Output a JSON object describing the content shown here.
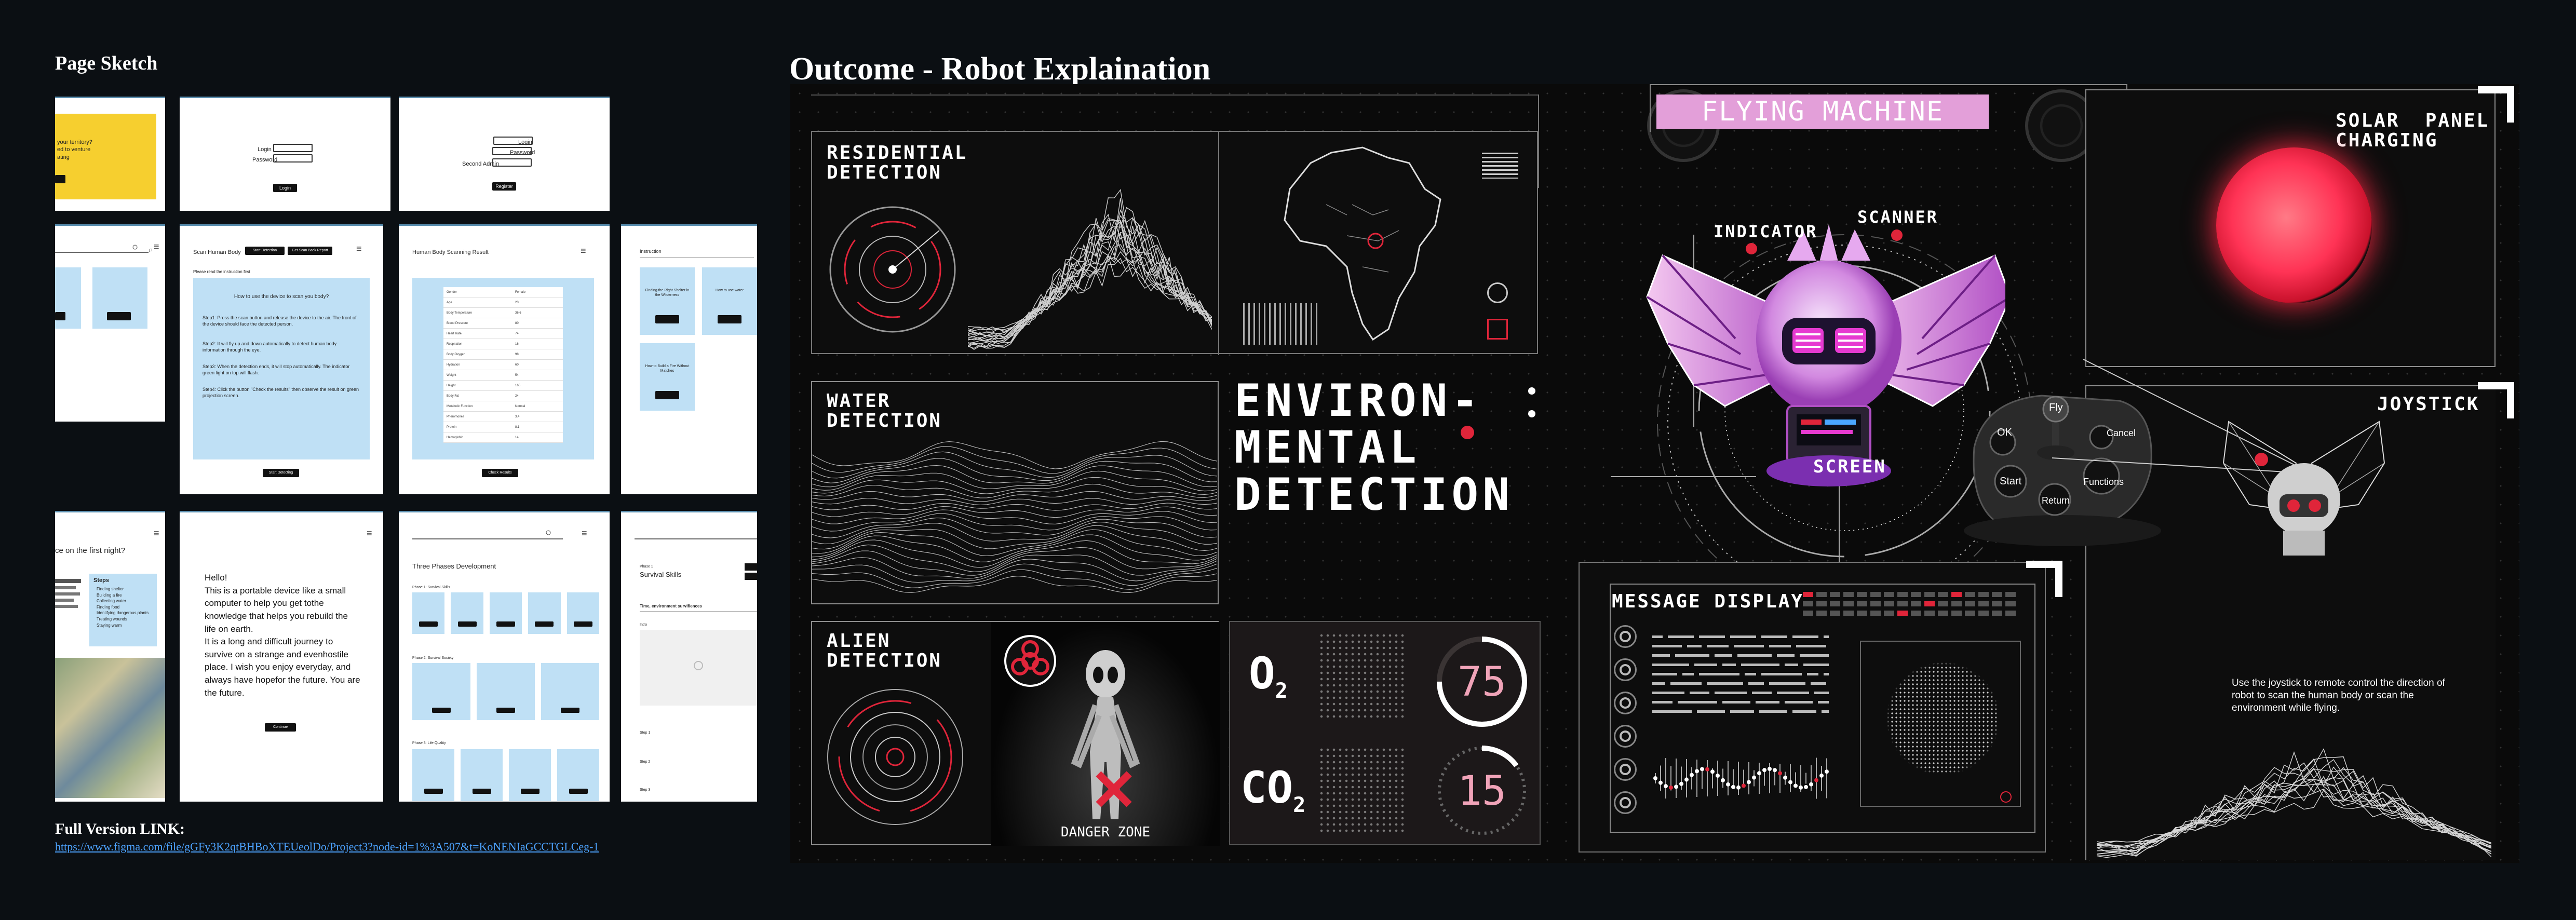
{
  "left": {
    "heading": "Page Sketch",
    "link_label": "Full Version LINK:",
    "link_url": "https://www.figma.com/file/gGFy3K2qtBHBoXTEUeolDo/Project3?node-id=1%3A507&t=KoNENIaGCCTGLCeg-1",
    "frames": {
      "f1_lines": [
        "your territory?",
        "ed to venture",
        "ating"
      ],
      "login_labels": [
        "Login",
        "Password"
      ],
      "login_btn": "Login",
      "register_labels": [
        "Login",
        "Password",
        "Second Admin"
      ],
      "register_btn": "Register",
      "scan_title": "Scan Human Body",
      "scan_tabs": [
        "Start Detection",
        "Get Scan Back Report"
      ],
      "scan_note": "Please read the instruction first",
      "scan_question": "How to use the device to scan you body?",
      "scan_steps": [
        "Step1: Press the scan button and release the device to the air. The front of the device should face the detected person.",
        "Step2: It will fly up and down automatically to detect human body information through the eye.",
        "Step3: When the detection ends, it will stop automatically. The indicator green light on top will flash.",
        "Step4: Click the button \"Check the results\" then observe the result on green projection screen."
      ],
      "scan_btn": "Start Detecting",
      "result_title": "Human Body Scanning Result",
      "result_rows": [
        [
          "Gender",
          "Female"
        ],
        [
          "Age",
          "23"
        ],
        [
          "Body Temperature",
          "36.6"
        ],
        [
          "Blood Pressure",
          "80"
        ],
        [
          "Heart Rate",
          "74"
        ],
        [
          "Respiration",
          "16"
        ],
        [
          "Body Oxygen",
          "98"
        ],
        [
          "Hydration",
          "60"
        ],
        [
          "Weight",
          "54"
        ],
        [
          "Height",
          "165"
        ],
        [
          "Body Fat",
          "24"
        ],
        [
          "Metabolic Function",
          "Normal"
        ],
        [
          "Pheromones",
          "3.4"
        ],
        [
          "Protein",
          "8.1"
        ],
        [
          "Hemoglobin",
          "14"
        ]
      ],
      "result_btn": "Check Results",
      "r4_tab": "Instruction",
      "r4_cards": [
        "Finding the Right Shelter in the Wilderness",
        "How to use water",
        "How to Build a Fire Without Matches"
      ],
      "r5_text": "ce on the first night?",
      "r5_steps_title": "Steps",
      "r5_steps": [
        "Finding shelter",
        "Building a fire",
        "Collecting water",
        "Finding food",
        "Identifying dangerous plants",
        "Treating wounds",
        "Staying warm"
      ],
      "hello_lines": [
        "Hello!",
        "This is a portable device like a small",
        "computer to help you get tothe",
        "knowledge that helps you rebuild the",
        "life on earth.",
        "It is a long and difficult journey to",
        "survive on a strange and evenhostile",
        "place. I wish you enjoy everyday, and",
        "always have hopefor the future. You are",
        "the future."
      ],
      "hello_btn": "Continue",
      "phases_title": "Three Phases Development",
      "phases": [
        "Phase 1: Survival Skills",
        "Phase 2: Survival Society",
        "Phase 3: Life Quality"
      ],
      "survival_small": "Phase 1",
      "survival_title": "Survival Skills",
      "survival_sub": "Time, environment surviflences",
      "survival_video": "Intro",
      "survival_steps": [
        "Step 1",
        "Step 2",
        "Step 3"
      ]
    }
  },
  "board": {
    "title": "Outcome - Robot Explaination",
    "residential": "RESIDENTIAL\nDETECTION",
    "water": "WATER\nDETECTION",
    "alien": "ALIEN\nDETECTION",
    "environmental": "ENVIRON-\nMENTAL\nDETECTION",
    "danger": "DANGER ZONE",
    "o2": "O",
    "o2_sub": "2",
    "o2_value": "75",
    "o2_percent": 0.75,
    "co2": "CO",
    "co2_sub": "2",
    "co2_value": "15",
    "co2_percent": 0.15,
    "flying": "FLYING MACHINE",
    "indicator": "INDICATOR",
    "scanner": "SCANNER",
    "screen": "SCREEN",
    "message": "MESSAGE DISPLAY",
    "solar": "SOLAR  PANEL\nCHARGING",
    "joystick": "JOYSTICK",
    "joy_buttons": {
      "ok": "OK",
      "fly": "Fly",
      "cancel": "Cancel",
      "start": "Start",
      "return": "Return",
      "functions": "Functions"
    },
    "joystick_desc": "Use the joystick to remote control the direction of robot to scan the human body or scan the environment while flying."
  },
  "colors": {
    "accent_red": "#e0253a",
    "pink_label": "#e39fd9",
    "sun": "#ff3355",
    "mono_pink": "#f0a3b8"
  }
}
